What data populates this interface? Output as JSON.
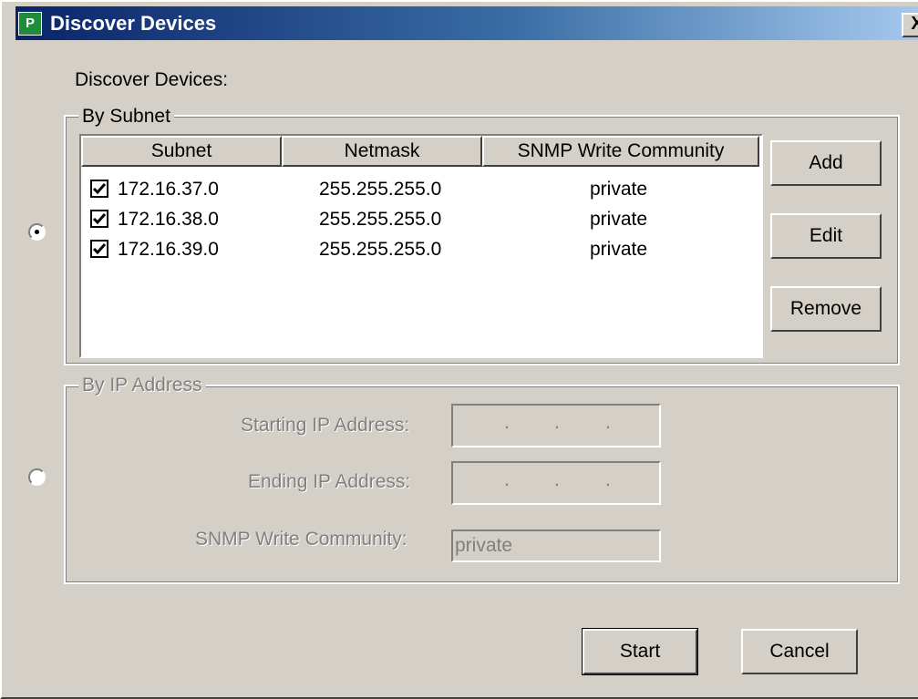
{
  "window": {
    "title": "Discover Devices",
    "icon": "app-icon",
    "close_label": "X"
  },
  "heading": "Discover Devices:",
  "by_subnet": {
    "group_title": "By Subnet",
    "selected": true,
    "columns": [
      "Subnet",
      "Netmask",
      "SNMP Write Community"
    ],
    "rows": [
      {
        "checked": true,
        "subnet": "172.16.37.0",
        "netmask": "255.255.255.0",
        "community": "private"
      },
      {
        "checked": true,
        "subnet": "172.16.38.0",
        "netmask": "255.255.255.0",
        "community": "private"
      },
      {
        "checked": true,
        "subnet": "172.16.39.0",
        "netmask": "255.255.255.0",
        "community": "private"
      }
    ],
    "buttons": {
      "add": "Add",
      "edit": "Edit",
      "remove": "Remove"
    }
  },
  "by_ip": {
    "group_title": "By IP Address",
    "selected": false,
    "starting_label": "Starting IP Address:",
    "ending_label": "Ending IP Address:",
    "community_label": "SNMP Write Community:",
    "community_value": "private",
    "ip_separator": "."
  },
  "footer": {
    "start_label": "Start",
    "cancel_label": "Cancel"
  },
  "colors": {
    "titlebar_start": "#0a246a",
    "titlebar_end": "#a6caf0",
    "dialog_bg": "#d4d0c8",
    "disabled_text": "#808080"
  }
}
